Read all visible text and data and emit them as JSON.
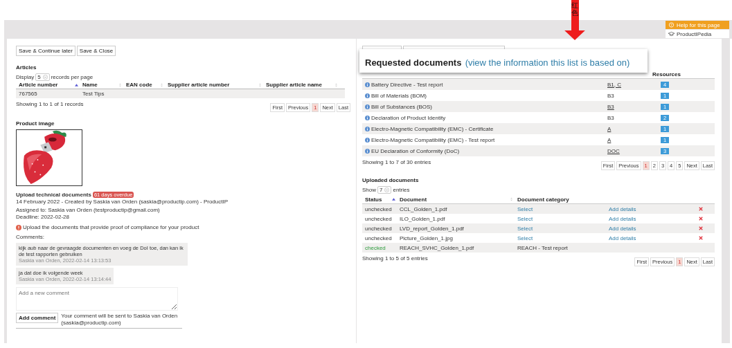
{
  "annotation": {
    "text": "红色"
  },
  "help_menu": [
    {
      "kind": "help",
      "label": "Help for this page"
    },
    {
      "kind": "pedia",
      "label": "ProductIPedia"
    }
  ],
  "left": {
    "buttons": [
      "Save & Continue later",
      "Save & Close"
    ],
    "articles": {
      "title": "Articles",
      "display_label": "Display",
      "per_page": "5",
      "per_page_suffix": "records per page",
      "columns": [
        {
          "label": "Article number",
          "sorted": true
        },
        {
          "label": "Name",
          "sorted": false
        },
        {
          "label": "EAN code",
          "sorted": false
        },
        {
          "label": "Supplier article number",
          "sorted": false
        },
        {
          "label": "Supplier article name",
          "sorted": false
        }
      ],
      "rows": [
        {
          "article_number": "767565",
          "name": "Test Tips"
        }
      ],
      "info": "Showing 1 to 1 of 1 records",
      "pagination": [
        {
          "label": "First",
          "selected": false
        },
        {
          "label": "Previous",
          "selected": false
        },
        {
          "label": "1",
          "selected": true
        },
        {
          "label": "Next",
          "selected": false
        },
        {
          "label": "Last",
          "selected": false
        }
      ]
    },
    "product_image": {
      "title": "Product image",
      "kind": "picture"
    },
    "task": {
      "title": "Upload technical documents",
      "badge": "61 days overdue",
      "created": "14 February 2022 - Created by Saskia van Orden (saskia@productip.com) - ProductIP",
      "assigned": "Assigned to: Saskia van Orden (testproductip@gmail.com)",
      "deadline": "Deadline: 2022-02-28",
      "notice": "Upload the documents that provide proof of compliance for your product"
    },
    "comments": {
      "label": "Comments:",
      "items": [
        {
          "text": "kijk aub naar de gevraagde documenten en voeg de DoI toe, dan kan ik de test rapporten gebruiken",
          "meta": "Saskia van Orden, 2022-02-14 13:13:53"
        },
        {
          "text": "ja dat doe ik volgende week",
          "meta": "Saskia van Orden, 2022-02-14 13:14:44"
        }
      ],
      "placeholder": "Add a new comment",
      "button": "Add comment",
      "note": "Your comment will be sent to Saskia van Orden (saskia@productip.com)"
    }
  },
  "right": {
    "popup": {
      "title": "Requested documents",
      "link": "(view the information this list is based on)"
    },
    "requested": {
      "resources_header": "Resources",
      "rows": [
        {
          "name": "Battery Directive - Test report",
          "code": "B1, C",
          "linked": true,
          "count": "4"
        },
        {
          "name": "Bill of Materials (BOM)",
          "code": "B3",
          "linked": false,
          "count": "1"
        },
        {
          "name": "Bill of Substances (BOS)",
          "code": "B3",
          "linked": true,
          "count": "1"
        },
        {
          "name": "Declaration of Product Identity",
          "code": "B3",
          "linked": false,
          "count": "2"
        },
        {
          "name": "Electro-Magnetic Compatibility (EMC) - Certificate",
          "code": "A",
          "linked": true,
          "count": "1"
        },
        {
          "name": "Electro-Magnetic Compatibility (EMC) - Test report",
          "code": "A",
          "linked": true,
          "count": "1"
        },
        {
          "name": "EU Declaration of Conformity (DoC)",
          "code": "DOC",
          "linked": true,
          "count": "3"
        }
      ],
      "info": "Showing 1 to 7 of 30 entries",
      "pagination": [
        {
          "label": "First",
          "selected": false
        },
        {
          "label": "Previous",
          "selected": false
        },
        {
          "label": "1",
          "selected": true
        },
        {
          "label": "2",
          "selected": false
        },
        {
          "label": "3",
          "selected": false
        },
        {
          "label": "4",
          "selected": false
        },
        {
          "label": "5",
          "selected": false
        },
        {
          "label": "Next",
          "selected": false
        },
        {
          "label": "Last",
          "selected": false
        }
      ]
    },
    "uploaded": {
      "title": "Uploaded documents",
      "show_label": "Show",
      "per_page": "7",
      "per_page_suffix": "entries",
      "columns": [
        {
          "label": "Status",
          "sorted": true
        },
        {
          "label": "Document",
          "sorted": false
        },
        {
          "label": "Document category"
        }
      ],
      "rows": [
        {
          "status": "unchecked",
          "checked": false,
          "document": "CCL_Golden_1.pdf",
          "select": "Select",
          "details": "Add details"
        },
        {
          "status": "unchecked",
          "checked": false,
          "document": "ILO_Golden_1.pdf",
          "select": "Select",
          "details": "Add details"
        },
        {
          "status": "unchecked",
          "checked": false,
          "document": "LVD_report_Golden_1.pdf",
          "select": "Select",
          "details": "Add details"
        },
        {
          "status": "unchecked",
          "checked": false,
          "document": "Picture_Golden_1.jpg",
          "select": "Select",
          "details": "Add details"
        },
        {
          "status": "checked",
          "checked": true,
          "document": "REACH_SVHC_Golden_1.pdf",
          "category": "REACH - Test report"
        }
      ],
      "info": "Showing 1 to 5 of 5 entries",
      "pagination": [
        {
          "label": "First",
          "selected": false
        },
        {
          "label": "Previous",
          "selected": false
        },
        {
          "label": "1",
          "selected": true
        },
        {
          "label": "Next",
          "selected": false
        },
        {
          "label": "Last",
          "selected": false
        }
      ]
    }
  }
}
